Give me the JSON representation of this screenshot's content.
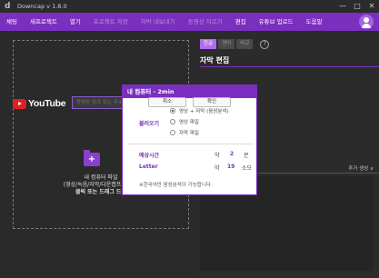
{
  "window": {
    "title": "Downcap v 1.8.0",
    "logo": "d"
  },
  "window_controls": [
    "—",
    "□",
    "✕"
  ],
  "menu": [
    {
      "label": "채팅",
      "enabled": true
    },
    {
      "label": "새프로젝트",
      "enabled": true
    },
    {
      "label": "열기",
      "enabled": true
    },
    {
      "label": "프로젝트 저장",
      "enabled": false
    },
    {
      "label": "자막 내보내기",
      "enabled": false
    },
    {
      "label": "동영상 자르기",
      "enabled": false
    },
    {
      "label": "편집",
      "enabled": true
    },
    {
      "label": "유튜브 업로드",
      "enabled": true
    },
    {
      "label": "도움말",
      "enabled": true
    }
  ],
  "left": {
    "youtube_text": "YouTube",
    "url_placeholder": "동영상 링크 또는 주소를 입력하세요",
    "folder_plus": "+",
    "drop_line1": "내 컴퓨터 파일",
    "drop_line2": "(영상/녹음/자막/다운캡프로젝트)",
    "drop_line3": "클릭 또는 드래그 드랍"
  },
  "right": {
    "tabs": [
      "한글",
      "영어",
      "비교"
    ],
    "help": "?",
    "title": "자막 편집",
    "sort_label": "추가 생성 ∨"
  },
  "modal": {
    "title": "내 컴퓨터 - 2min",
    "import_label": "불러오기",
    "options": [
      {
        "label": "영상 + 자막 (음성분석)",
        "checked": true
      },
      {
        "label": "영상 파일",
        "checked": false
      },
      {
        "label": "자막 파일",
        "checked": false
      }
    ],
    "est_time_label": "예상시간",
    "est_time_prefix": "약",
    "est_time_value": "2",
    "est_time_unit": "분",
    "letter_label": "Letter",
    "letter_prefix": "약",
    "letter_value": "19",
    "letter_unit": "소모",
    "note": "※한국어만 음성분석이 가능합니다.",
    "cancel": "취소",
    "confirm": "확인"
  },
  "colors": {
    "accent": "#7b2fbe",
    "accent_light": "#b06cf0",
    "youtube_red": "#e02020"
  }
}
